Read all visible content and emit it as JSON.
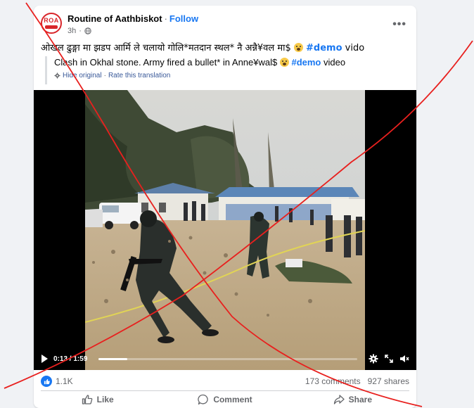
{
  "post": {
    "page_name": "Routine of Aathbiskot",
    "follow_label": "Follow",
    "separator": "·",
    "time": "3h",
    "avatar_text": "ROA",
    "more_label": "•••",
    "text_before": "ओखल ढुङ्गा मा झडप आर्मि ले चलायो गोलि*मतदान स्थल* नै अन्नै¥वल मा$ ",
    "hashtag": "#demo",
    "text_after": " vido"
  },
  "translation": {
    "text_before": "Clash in Okhal stone. Army fired a bullet* in Anne¥wal$ ",
    "hashtag": "#demo",
    "text_after": " video",
    "hide_original": "Hide original",
    "dot": "·",
    "rate": "Rate this translation"
  },
  "video": {
    "current_time": "0:13",
    "duration": "1:59",
    "time_sep": " / ",
    "progress": 0.11
  },
  "stats": {
    "likes": "1.1K",
    "comments": "173 comments",
    "shares": "927 shares"
  },
  "actions": {
    "like": "Like",
    "comment": "Comment",
    "share": "Share"
  },
  "colors": {
    "brand": "#1877f2",
    "cross": "#e8201e"
  },
  "icons": [
    "globe-icon",
    "more-icon",
    "gear-icon",
    "play-icon",
    "settings-icon",
    "fullscreen-icon",
    "volume-icon",
    "like-reaction-icon",
    "like-icon",
    "comment-icon",
    "share-icon"
  ]
}
